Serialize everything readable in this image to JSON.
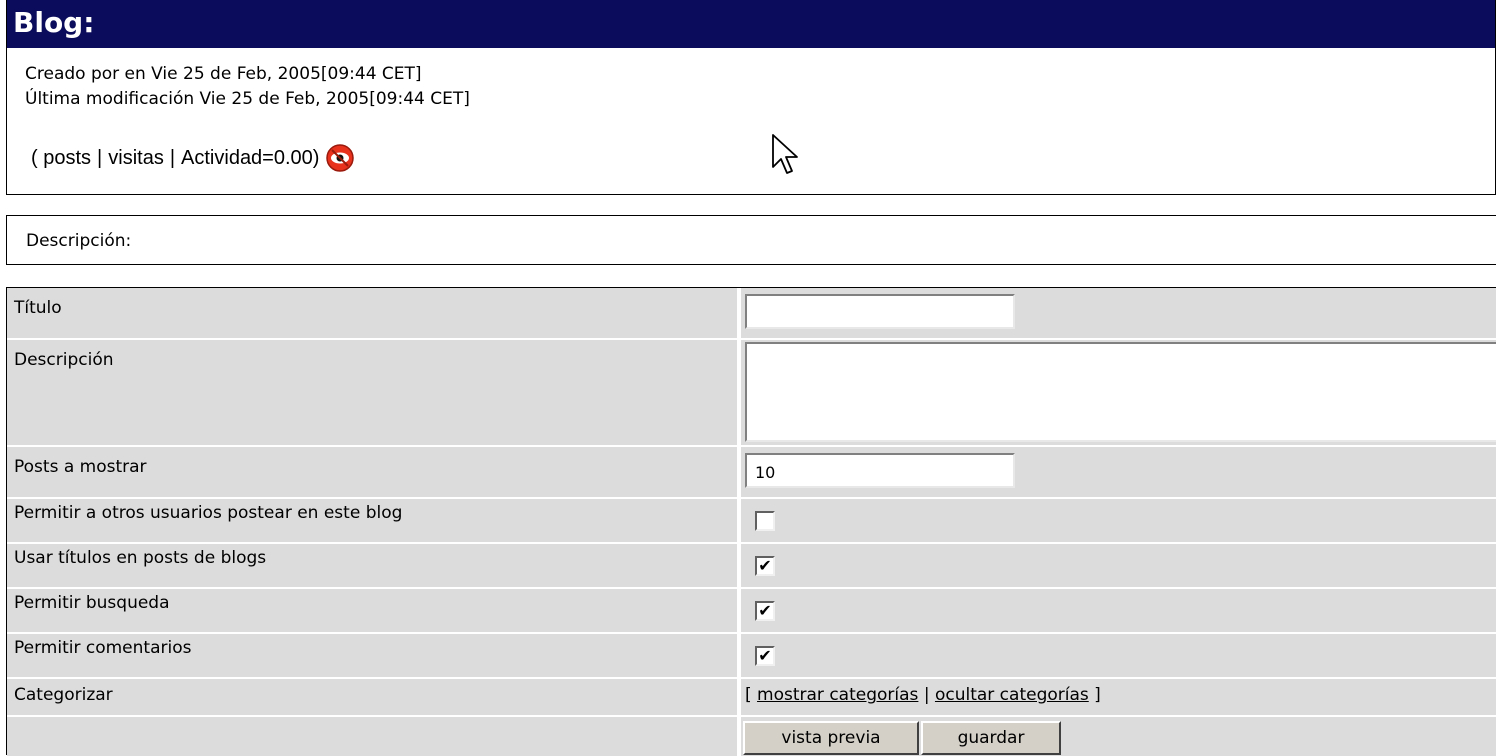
{
  "header": {
    "title": "Blog:"
  },
  "meta": {
    "created": "Creado por en Vie 25 de Feb, 2005[09:44 CET]",
    "modified": "Última modificación Vie 25 de Feb, 2005[09:44 CET]"
  },
  "stats": {
    "open": "(",
    "posts": "posts",
    "visits": "visitas",
    "activity": "Actividad=0.00)",
    "sep": "|",
    "icon": "monitor-eye-icon"
  },
  "description_box": {
    "label": "Descripción:"
  },
  "form": {
    "title_label": "Título",
    "title_value": "",
    "description_label": "Descripción",
    "posts_label": "Posts a mostrar",
    "posts_value": "10",
    "allow_others_label": "Permitir a otros usuarios postear en este blog",
    "allow_others_checked": false,
    "use_titles_label": "Usar títulos en posts de blogs",
    "use_titles_checked": true,
    "allow_search_label": "Permitir busqueda",
    "allow_search_checked": true,
    "allow_comments_label": "Permitir comentarios",
    "allow_comments_checked": true,
    "categorize_label": "Categorizar",
    "cat_open": "[",
    "cat_show": "mostrar categorías",
    "cat_sep": "|",
    "cat_hide": "ocultar categorías",
    "cat_close": "]",
    "preview_button": "vista previa",
    "save_button": "guardar",
    "check_mark": "✔"
  },
  "colors": {
    "header_bg": "#0c0c5c",
    "row_bg": "#dcdcdc"
  }
}
